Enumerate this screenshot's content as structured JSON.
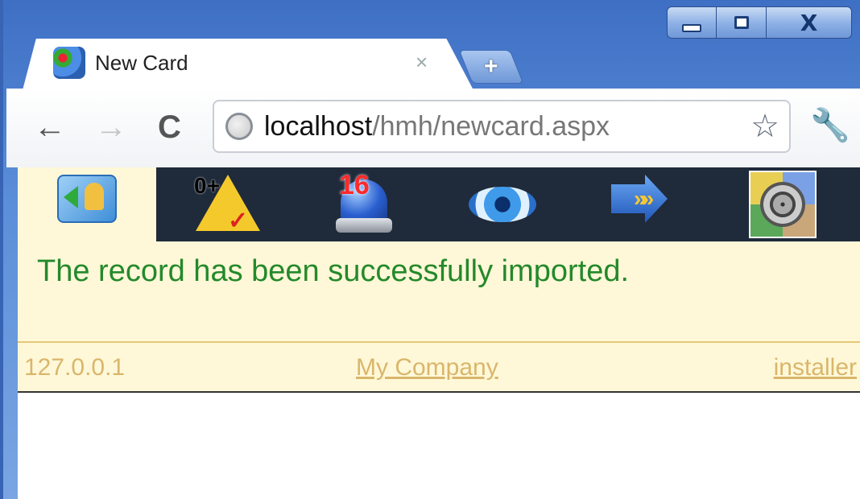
{
  "window": {
    "tab_title": "New Card",
    "tab_close": "×",
    "new_tab": "+",
    "close_glyph": "X"
  },
  "toolbar": {
    "back": "←",
    "forward": "→",
    "reload": "C",
    "url_host": "localhost",
    "url_path": "/hmh/newcard.aspx",
    "star": "☆",
    "wrench": "🔧"
  },
  "iconbar": {
    "items": [
      {
        "icon": "new-card-icon"
      },
      {
        "icon": "alert-person-icon",
        "label": "0+"
      },
      {
        "icon": "siren-icon",
        "label": "16"
      },
      {
        "icon": "eye-icon"
      },
      {
        "icon": "forward-arrow-icon",
        "label": "»»"
      },
      {
        "icon": "target-icon"
      }
    ]
  },
  "message": "The record has been successfully imported.",
  "footer": {
    "ip": "127.0.0.1",
    "company": "My Company",
    "user": "installer"
  },
  "colors": {
    "success_text": "#24892b",
    "footer_text": "#d9b66b",
    "panel_bg": "#fff8d8",
    "iconbar_bg": "#1f2a3a"
  }
}
